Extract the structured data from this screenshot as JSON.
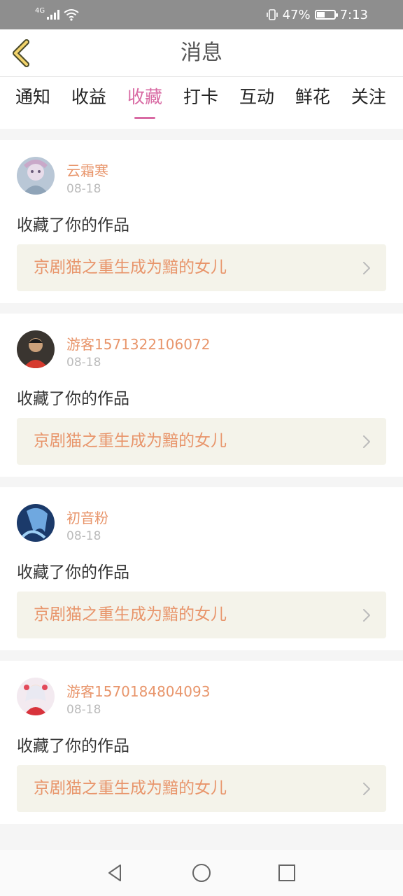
{
  "status_bar": {
    "network": "4G",
    "battery": "47%",
    "battery_level": 0.47,
    "time": "7:13"
  },
  "header": {
    "back_icon": "chevron-left-icon",
    "title": "消息"
  },
  "tabs": [
    {
      "label": "通知",
      "active": false
    },
    {
      "label": "收益",
      "active": false
    },
    {
      "label": "收藏",
      "active": true
    },
    {
      "label": "打卡",
      "active": false
    },
    {
      "label": "互动",
      "active": false
    },
    {
      "label": "鲜花",
      "active": false
    },
    {
      "label": "关注",
      "active": false
    }
  ],
  "messages": [
    {
      "username": "云霜寒",
      "date": "08-18",
      "action": "收藏了你的作品",
      "work_title": "京剧猫之重生成为黯的女儿"
    },
    {
      "username": "游客1571322106072",
      "date": "08-18",
      "action": "收藏了你的作品",
      "work_title": "京剧猫之重生成为黯的女儿"
    },
    {
      "username": "初音粉",
      "date": "08-18",
      "action": "收藏了你的作品",
      "work_title": "京剧猫之重生成为黯的女儿"
    },
    {
      "username": "游客1570184804093",
      "date": "08-18",
      "action": "收藏了你的作品",
      "work_title": "京剧猫之重生成为黯的女儿"
    }
  ],
  "colors": {
    "accent_pink": "#d86aa3",
    "username_orange": "#e8956b",
    "back_icon_yellow": "#f2d36b",
    "work_bg": "#f4f3ea"
  },
  "nav_bar": {
    "back": "triangle-back-icon",
    "home": "circle-home-icon",
    "recents": "square-recents-icon"
  }
}
